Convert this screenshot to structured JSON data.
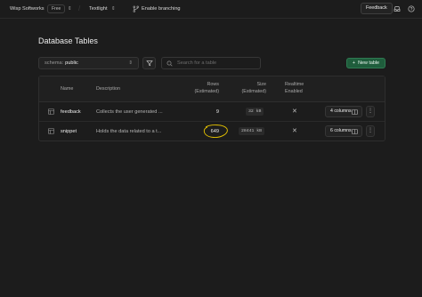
{
  "topbar": {
    "org_name": "Wisp Softworks",
    "plan_badge": "Free",
    "project_name": "Textlight",
    "branching_label": "Enable branching",
    "feedback_label": "Feedback",
    "icons": [
      "chevron-updown-icon",
      "git-branch-icon",
      "inbox-icon",
      "help-circle-icon"
    ]
  },
  "page": {
    "title": "Database Tables"
  },
  "toolbar": {
    "schema_label": "schema:",
    "schema_value": "public",
    "search_placeholder": "Search for a table",
    "new_table_label": "New table"
  },
  "table": {
    "headers": {
      "name": "Name",
      "description": "Description",
      "rows_line1": "Rows",
      "rows_line2": "(Estimated)",
      "size_line1": "Size",
      "size_line2": "(Estimated)",
      "realtime_line1": "Realtime",
      "realtime_line2": "Enabled"
    },
    "rows": [
      {
        "name": "feedback",
        "description": "Collects the user generated ...",
        "rows": "9",
        "size": "32 kB",
        "realtime": "✕",
        "columns": "4 columns",
        "more": "⋮"
      },
      {
        "name": "snippet",
        "description": "Holds the data related to a t...",
        "rows": "649",
        "size": "28441 kB",
        "realtime": "✕",
        "columns": "6 columns",
        "more": "⋮"
      }
    ]
  },
  "colors": {
    "background": "#1c1c1c",
    "accent_green": "#1f5d3c",
    "annotation_circle": "#e6c300"
  }
}
